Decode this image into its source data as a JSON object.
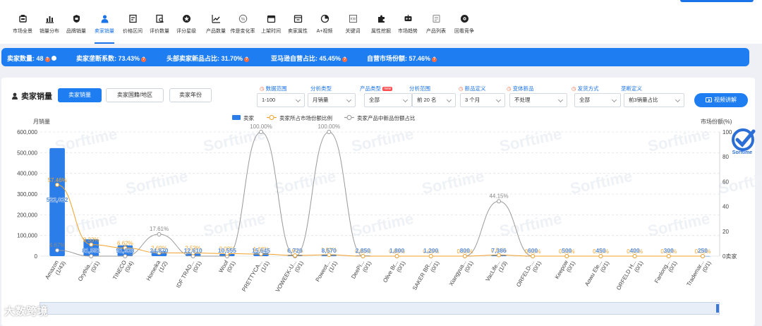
{
  "nav": {
    "items": [
      {
        "label": "市场全景",
        "icon": "market-icon"
      },
      {
        "label": "销量分布",
        "icon": "bar-chart-icon"
      },
      {
        "label": "品牌销量",
        "icon": "shield-icon"
      },
      {
        "label": "卖家销量",
        "icon": "seller-icon",
        "active": true
      },
      {
        "label": "价格区间",
        "icon": "price-icon"
      },
      {
        "label": "评价数量",
        "icon": "review-icon"
      },
      {
        "label": "评分星级",
        "icon": "star-icon"
      },
      {
        "label": "产品数量",
        "icon": "trend-icon"
      },
      {
        "label": "传是变化率",
        "icon": "percent-icon"
      },
      {
        "label": "上架时间",
        "icon": "calendar-icon"
      },
      {
        "label": "卖家属性",
        "icon": "seller-attr-icon"
      },
      {
        "label": "A+视频",
        "icon": "pie-icon"
      },
      {
        "label": "关键词",
        "icon": "keyword-icon"
      },
      {
        "label": "属性挖掘",
        "icon": "puzzle-icon"
      },
      {
        "label": "市场趋势",
        "icon": "robot-icon"
      },
      {
        "label": "产品列表",
        "icon": "list-icon"
      },
      {
        "label": "回看竞争",
        "icon": "compete-icon"
      }
    ]
  },
  "stats": [
    {
      "label": "卖家数量:",
      "value": "48"
    },
    {
      "label": "卖家垄断系数:",
      "value": "73.43%"
    },
    {
      "label": "头部卖家新品占比:",
      "value": "31.70%"
    },
    {
      "label": "亚马逊自营占比:",
      "value": "45.45%"
    },
    {
      "label": "自营市场份额:",
      "value": "57.46%"
    }
  ],
  "section": {
    "title": "卖家销量",
    "tabs": [
      "卖家销量",
      "卖家国籍/地区",
      "卖家年份"
    ]
  },
  "filters": [
    {
      "label": "数据范围",
      "value": "1-100",
      "icon": true
    },
    {
      "label": "分析类型",
      "value": "月销量"
    },
    {
      "label": "产品类型",
      "value": "全部",
      "badge": "new"
    },
    {
      "label": "分析范围",
      "value": "前 20 名"
    },
    {
      "label": "新品定义",
      "value": "3 个月",
      "icon": true
    },
    {
      "label": "变体新品",
      "value": "不处理",
      "icon": true
    },
    {
      "label": "发货方式",
      "value": "全部",
      "icon": true
    },
    {
      "label": "垄断定义",
      "value": "前3销量占比"
    }
  ],
  "video_button": "视频讲解",
  "chart_data": {
    "type": "bar",
    "ylabel_left": "月销量",
    "ylabel_right": "市场份额(%)",
    "right_axis_unit": "0卖家",
    "ylim_left": [
      0,
      600000
    ],
    "yticks_left": [
      "0",
      "100,000",
      "200,000",
      "300,000",
      "400,000",
      "500,000",
      "600,000"
    ],
    "ylim_right": [
      0,
      100
    ],
    "yticks_right": [
      "0",
      "20",
      "40",
      "60",
      "80",
      "100"
    ],
    "legend": [
      "卖家",
      "卖家所占市场份额比例",
      "卖家产品中新品份额占比"
    ],
    "categories": [
      {
        "name": "Amazon",
        "sub": "(1/43)"
      },
      {
        "name": "Orythia...",
        "sub": "(0/1)"
      },
      {
        "name": "TINECO",
        "sub": "(0/4)"
      },
      {
        "name": "Homeika",
        "sub": "(1/2)"
      },
      {
        "name": "IDF TRAD...",
        "sub": "(0/1)"
      },
      {
        "name": "Woof",
        "sub": "(0/1)"
      },
      {
        "name": "PRETTYCA...",
        "sub": "(1/1)"
      },
      {
        "name": "VOWEEK-U...",
        "sub": "(0/1)"
      },
      {
        "name": "Poweot...",
        "sub": "(1/1)"
      },
      {
        "name": "DeePi...",
        "sub": "(0/1)"
      },
      {
        "name": "Olive Br...",
        "sub": "(0/1)"
      },
      {
        "name": "SAKER BR...",
        "sub": "(0/1)"
      },
      {
        "name": "Xiangyua...",
        "sub": "(0/1)"
      },
      {
        "name": "VacLife...",
        "sub": "(1/3)"
      },
      {
        "name": "ORFELD-...",
        "sub": "(0/1)"
      },
      {
        "name": "Keepow",
        "sub": "(0/1)"
      },
      {
        "name": "Aowu Ele...",
        "sub": "(0/1)"
      },
      {
        "name": "ORFELD H...",
        "sub": "(0/1)"
      },
      {
        "name": "Fanlong...",
        "sub": "(0/1)"
      },
      {
        "name": "Trademar...",
        "sub": "(0/1)"
      }
    ],
    "series": [
      {
        "name": "卖家",
        "type": "bar",
        "color": "#2b7de9",
        "values": [
          522022,
          81551,
          51928,
          24870,
          12610,
          10555,
          15645,
          6720,
          8570,
          2850,
          1800,
          1200,
          800,
          7386,
          600,
          500,
          450,
          400,
          300,
          250
        ],
        "labels": [
          "522,022",
          "81,551",
          "51,928",
          "24,870",
          "12,610",
          "10,555",
          "15,645",
          "6,720",
          "8,570",
          "2,850",
          "1,800",
          "1,200",
          "800",
          "7,386",
          "600",
          "500",
          "450",
          "400",
          "300",
          "250"
        ]
      },
      {
        "name": "卖家所占市场份额比例",
        "type": "line",
        "color": "#f0a22a",
        "values": [
          57.46,
          9.33,
          6.62,
          2.69,
          2.53,
          2.08,
          1.68,
          0.6,
          1.03,
          0.0,
          0.0,
          0.0,
          0.0,
          0.84,
          0.0,
          0.0,
          0.0,
          0.0,
          0.0,
          0.0
        ],
        "labels": [
          "57.46%",
          "9.33%",
          "6.62%",
          "2.69%",
          "2.53%",
          "2.08%",
          "1.68%",
          "0.60%",
          "1.03%",
          "0.00%",
          "0.00%",
          "0.00%",
          "0.00%",
          "0.84%",
          "0.00%",
          "0.00%",
          "0.00%",
          "0.00%",
          "0.00%",
          "0.00%"
        ]
      },
      {
        "name": "卖家产品中新品份额占比",
        "type": "line",
        "color": "#999999",
        "values": [
          4.67,
          0,
          0,
          17.61,
          0,
          0,
          100,
          0,
          100,
          0,
          0,
          0,
          0,
          44.15,
          0,
          0,
          0,
          0,
          0,
          0
        ],
        "labels": [
          "4.67%",
          "",
          "",
          "17.61%",
          "",
          "",
          "100.00%",
          "",
          "100.00%",
          "",
          "",
          "",
          "",
          "44.15%",
          "",
          "",
          "",
          "",
          "",
          ""
        ]
      }
    ]
  },
  "watermark": "Sorftime",
  "badge_text": "Sorftime",
  "bottom_logo": "大数跨境",
  "colors": {
    "accent": "#1e7df0",
    "bar": "#2b7de9",
    "share_line": "#f0a22a",
    "new_line": "#999999",
    "warn": "#ff6b3d"
  }
}
